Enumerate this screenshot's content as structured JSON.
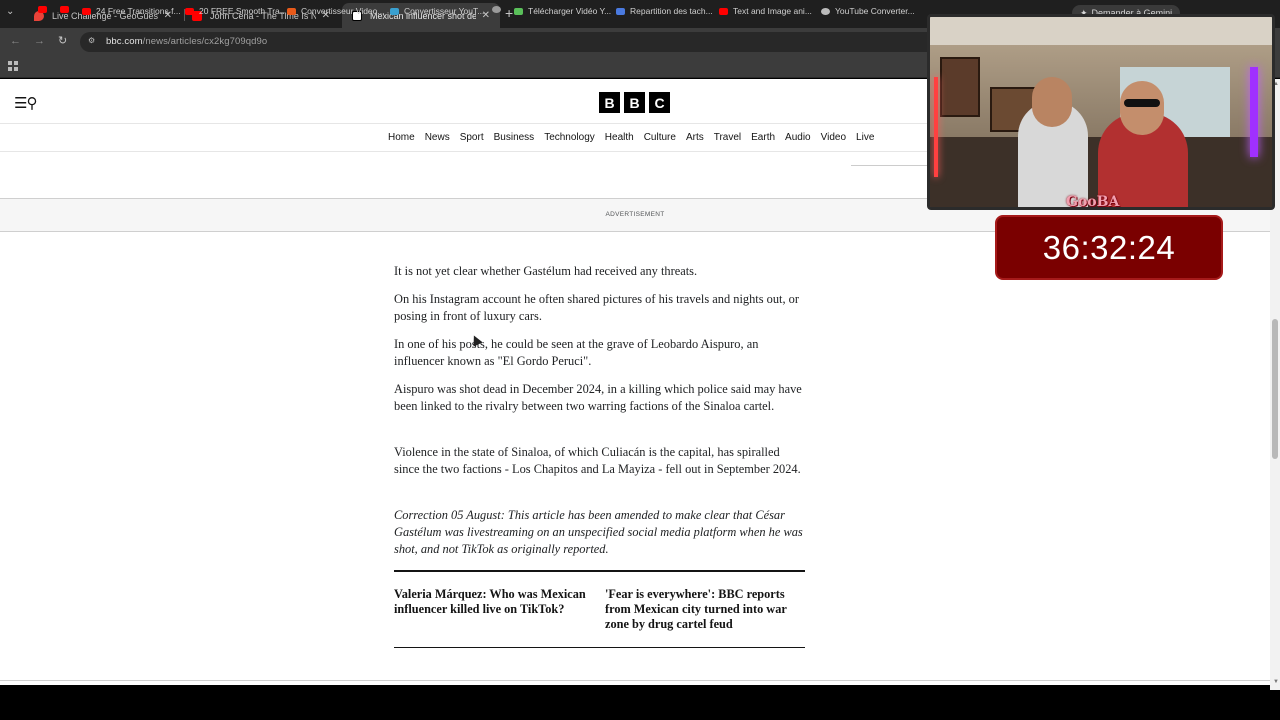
{
  "tabs": [
    {
      "title": "Live Challenge - GeoGuessr",
      "favicon_color": "#e8443a",
      "active": false
    },
    {
      "title": "John Cena - The Time Is Now (",
      "favicon_color": "#ff0000",
      "active": false
    },
    {
      "title": "Mexican influencer shot dead d",
      "favicon_color": "#ffffff",
      "active": true
    }
  ],
  "gemini_button": "Demander à Gemini",
  "address": {
    "domain": "bbc.com",
    "path": "/news/articles/cx2kg709qd9o"
  },
  "bookmarks": [
    {
      "label": "",
      "color": "#ff0000"
    },
    {
      "label": "",
      "color": "#ff0000"
    },
    {
      "label": "24 Free Transitions f...",
      "color": "#ff0000"
    },
    {
      "label": "20 FREE Smooth Tra...",
      "color": "#ff0000"
    },
    {
      "label": "Convertisseur Video...",
      "color": "#e85a1a"
    },
    {
      "label": "Convertisseur YouT...",
      "color": "#3aa0d0"
    },
    {
      "label": "",
      "color": "#9a9a9a"
    },
    {
      "label": "Télécharger Vidéo Y...",
      "color": "#5ac05a"
    },
    {
      "label": "Repartition des tach...",
      "color": "#4a7ae0"
    },
    {
      "label": "Text and Image ani...",
      "color": "#ff0000"
    },
    {
      "label": "YouTube Converter...",
      "color": "#bbbbbb"
    }
  ],
  "site": {
    "logo_letters": [
      "B",
      "B",
      "C"
    ],
    "nav": [
      "Home",
      "News",
      "Sport",
      "Business",
      "Technology",
      "Health",
      "Culture",
      "Arts",
      "Travel",
      "Earth",
      "Audio",
      "Video",
      "Live"
    ],
    "advertisement_label": "ADVERTISEMENT"
  },
  "article": {
    "paragraphs": [
      "It is not yet clear whether Gastélum had received any threats.",
      "On his Instagram account he often shared pictures of his travels and nights out, or posing in front of luxury cars.",
      "In one of his posts, he could be seen at the grave of Leobardo Aispuro, an influencer known as \"El Gordo Peruci\".",
      "Aispuro was shot dead in December 2024, in a killing which police said may have been linked to the rivalry between two warring factions of the Sinaloa cartel.",
      "Violence in the state of Sinaloa, of which Culiacán is the capital, has spiralled since the two factions - Los Chapitos and La Mayiza - fell out in September 2024."
    ],
    "correction": "Correction 05 August: This article has been amended to make clear that César Gastélum was livestreaming on an unspecified social media platform when he was shot, and not TikTok as originally reported.",
    "related": [
      "Valeria Márquez: Who was Mexican influencer killed live on TikTok?",
      "'Fear is everywhere': BBC reports from Mexican city turned into war zone by drug cartel feud"
    ]
  },
  "overlay": {
    "webcam_label": "GooBA",
    "timer": "36:32:24"
  }
}
